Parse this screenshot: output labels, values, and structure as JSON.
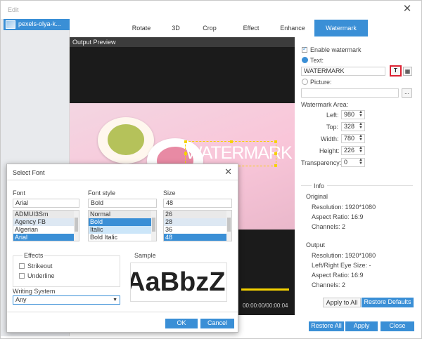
{
  "window": {
    "title": "Edit"
  },
  "file": {
    "name": "pexels-olya-k..."
  },
  "tabs": [
    {
      "label": "Rotate"
    },
    {
      "label": "3D"
    },
    {
      "label": "Crop"
    },
    {
      "label": "Effect"
    },
    {
      "label": "Enhance"
    },
    {
      "label": "Watermark"
    }
  ],
  "preview": {
    "label": "Output Preview",
    "watermark_text": "WATERMARK",
    "timecode": "00:00:00/00:00:04"
  },
  "watermark": {
    "enable_label": "Enable watermark",
    "text_label": "Text:",
    "text_value": "WATERMARK",
    "text_btn": "T",
    "picture_label": "Picture:",
    "more_btn": "...",
    "area_label": "Watermark Area:",
    "left_label": "Left:",
    "left_value": "980",
    "top_label": "Top:",
    "top_value": "328",
    "width_label": "Width:",
    "width_value": "780",
    "height_label": "Height:",
    "height_value": "226",
    "transparency_label": "Transparency:",
    "transparency_value": "0"
  },
  "info": {
    "heading": "Info",
    "original_label": "Original",
    "orig_resolution": "Resolution: 1920*1080",
    "orig_aspect": "Aspect Ratio: 16:9",
    "orig_channels": "Channels: 2",
    "output_label": "Output",
    "out_resolution": "Resolution: 1920*1080",
    "out_eye": "Left/Right Eye Size: -",
    "out_aspect": "Aspect Ratio: 16:9",
    "out_channels": "Channels: 2"
  },
  "buttons": {
    "apply_all": "Apply to All",
    "restore_defaults": "Restore Defaults",
    "restore_all": "Restore All",
    "apply": "Apply",
    "close": "Close"
  },
  "font_dialog": {
    "title": "Select Font",
    "font_label": "Font",
    "font_value": "Arial",
    "fonts": [
      "ADMUI3Sm",
      "Agency FB",
      "Algerian",
      "Arial"
    ],
    "style_label": "Font style",
    "style_value": "Bold",
    "styles": [
      "Normal",
      "Bold",
      "Italic",
      "Bold Italic"
    ],
    "size_label": "Size",
    "size_value": "48",
    "sizes": [
      "26",
      "28",
      "36",
      "48"
    ],
    "effects_label": "Effects",
    "strikeout": "Strikeout",
    "underline": "Underline",
    "sample_label": "Sample",
    "sample_text": "AaBbzZ",
    "writing_label": "Writing System",
    "writing_value": "Any",
    "ok": "OK",
    "cancel": "Cancel"
  },
  "colors": {
    "accent": "#3a8fd6",
    "watermark_box": "#f5d200",
    "highlight": "#d22233"
  }
}
